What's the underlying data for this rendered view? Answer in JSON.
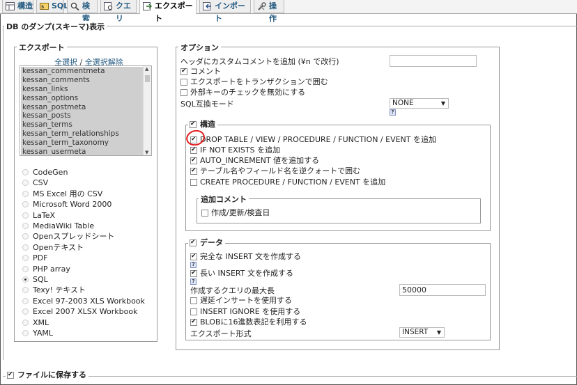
{
  "tabs": [
    {
      "label": "構造",
      "icon": "structure-icon"
    },
    {
      "label": "SQL",
      "icon": "sql-icon"
    },
    {
      "label": "検索",
      "icon": "search-icon"
    },
    {
      "label": "クエリ",
      "icon": "query-icon"
    },
    {
      "label": "エクスポート",
      "icon": "export-icon",
      "active": true
    },
    {
      "label": "インポート",
      "icon": "import-icon"
    },
    {
      "label": "操作",
      "icon": "operations-icon"
    }
  ],
  "dump_legend": "DB のダンプ(スキーマ)表示",
  "export": {
    "legend": "エクスポート",
    "select_all": "全選択",
    "separator": "/",
    "deselect_all": "全選択解除",
    "tables": [
      "kessan_commentmeta",
      "kessan_comments",
      "kessan_links",
      "kessan_options",
      "kessan_postmeta",
      "kessan_posts",
      "kessan_terms",
      "kessan_term_relationships",
      "kessan_term_taxonomy",
      "kessan_usermeta"
    ],
    "formats": [
      "CodeGen",
      "CSV",
      "MS Excel 用の CSV",
      "Microsoft Word 2000",
      "LaTeX",
      "MediaWiki Table",
      "Openスプレッドシート",
      "Openテキスト",
      "PDF",
      "PHP array",
      "SQL",
      "Texy! テキスト",
      "Excel 97-2003 XLS Workbook",
      "Excel 2007 XLSX Workbook",
      "XML",
      "YAML"
    ],
    "selected_format": "SQL"
  },
  "options": {
    "legend": "オプション",
    "header_comment_label": "ヘッダにカスタムコメントを追加 (¥n で改行)",
    "header_comment_value": "",
    "comments": "コメント",
    "transaction": "エクスポートをトランザクションで囲む",
    "disable_fk": "外部キーのチェックを無効にする",
    "compat_label": "SQL互換モード",
    "compat_value": "NONE",
    "help": "?",
    "structure": {
      "legend": "構造",
      "drop_table": "DROP TABLE / VIEW / PROCEDURE / FUNCTION / EVENT を追加",
      "if_not_exists": "IF NOT EXISTS を追加",
      "auto_increment": "AUTO_INCREMENT 値を追加する",
      "backquote": "テーブル名やフィールド名を逆クォートで囲む",
      "create_procedure": "CREATE PROCEDURE / FUNCTION / EVENT を追加",
      "extra_comment_legend": "追加コメント",
      "dates": "作成/更新/検査日"
    },
    "data": {
      "legend": "データ",
      "complete_insert": "完全な INSERT 文を作成する",
      "extended_insert": "長い INSERT 文を作成する",
      "max_query_label": "作成するクエリの最大長",
      "max_query_value": "50000",
      "delayed_insert": "遅延インサートを使用する",
      "insert_ignore": "INSERT IGNORE を使用する",
      "hex_blob": "BLOBに16進数表記を利用する",
      "export_type_label": "エクスポート形式",
      "export_type_value": "INSERT"
    }
  },
  "save_to_file": "ファイルに保存する"
}
